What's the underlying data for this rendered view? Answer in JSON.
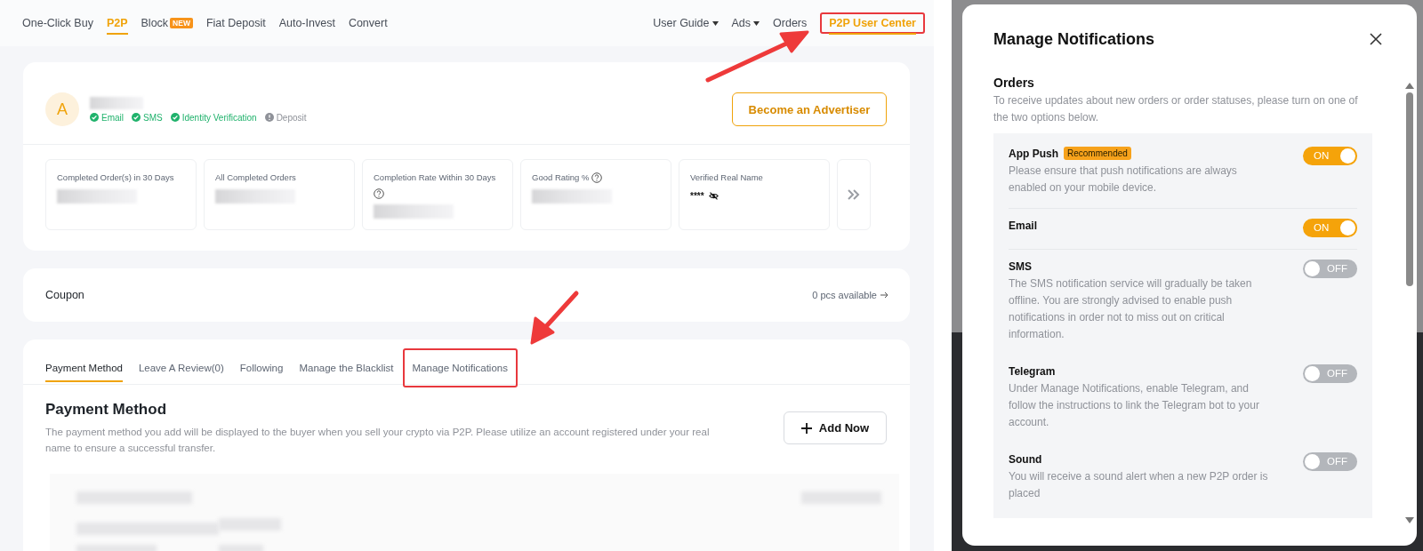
{
  "nav": {
    "items": [
      {
        "label": "One-Click Buy",
        "selected": false
      },
      {
        "label": "P2P",
        "selected": true
      },
      {
        "label": "Block",
        "selected": false,
        "badge": "NEW"
      },
      {
        "label": "Fiat Deposit",
        "selected": false
      },
      {
        "label": "Auto-Invest",
        "selected": false
      },
      {
        "label": "Convert",
        "selected": false
      }
    ],
    "right_items": [
      {
        "label": "User Guide",
        "dropdown": true,
        "selected": false,
        "highlighted": false
      },
      {
        "label": "Ads",
        "dropdown": true,
        "selected": false,
        "highlighted": false
      },
      {
        "label": "Orders",
        "dropdown": false,
        "selected": false,
        "highlighted": false
      },
      {
        "label": "P2P User Center",
        "dropdown": false,
        "selected": true,
        "highlighted": true
      }
    ]
  },
  "profile": {
    "avatar": "A",
    "verifications": [
      {
        "label": "Email",
        "verified": true
      },
      {
        "label": "SMS",
        "verified": true
      },
      {
        "label": "Identity Verification",
        "verified": true
      },
      {
        "label": "Deposit",
        "verified": false
      }
    ],
    "advertiser_button": "Become an Advertiser"
  },
  "stats": [
    {
      "label": "Completed Order(s) in 30 Days",
      "help": false,
      "kind": "redacted"
    },
    {
      "label": "All Completed Orders",
      "help": false,
      "kind": "redacted"
    },
    {
      "label": "Completion Rate Within 30 Days",
      "help": true,
      "kind": "redacted"
    },
    {
      "label": "Good Rating %",
      "help": true,
      "kind": "redacted"
    },
    {
      "label": "Verified Real Name",
      "help": false,
      "kind": "masked",
      "value": "****"
    }
  ],
  "coupon": {
    "label": "Coupon",
    "available": "0 pcs available"
  },
  "tabs": [
    {
      "label": "Payment Method",
      "selected": true,
      "highlighted": false
    },
    {
      "label": "Leave A Review(0)",
      "selected": false,
      "highlighted": false
    },
    {
      "label": "Following",
      "selected": false,
      "highlighted": false
    },
    {
      "label": "Manage the Blacklist",
      "selected": false,
      "highlighted": false
    },
    {
      "label": "Manage Notifications",
      "selected": false,
      "highlighted": true
    }
  ],
  "payment_method": {
    "title": "Payment Method",
    "description": "The payment method you add will be displayed to the buyer when you sell your crypto via P2P. Please utilize an account registered under your real name to ensure a successful transfer.",
    "add_button": "Add Now"
  },
  "modal": {
    "title": "Manage Notifications",
    "section": "Orders",
    "description": "To receive updates about new orders or order statuses, please turn on one of the two options below.",
    "options": [
      {
        "name": "App Push",
        "badge": "Recommended",
        "description": "Please ensure that push notifications are always enabled on your mobile device.",
        "on": true,
        "state_label": "ON",
        "divider": true
      },
      {
        "name": "Email",
        "on": true,
        "state_label": "ON",
        "divider": true
      },
      {
        "name": "SMS",
        "description": "The SMS notification service will gradually be taken offline. You are strongly advised to enable push notifications in order not to miss out on critical information.",
        "on": false,
        "state_label": "OFF",
        "divider": false
      },
      {
        "name": "Telegram",
        "description": "Under Manage Notifications, enable Telegram, and follow the instructions to link the Telegram bot to your account.",
        "on": false,
        "state_label": "OFF",
        "divider": false
      },
      {
        "name": "Sound",
        "description": "You will receive a sound alert when a new P2P order is placed",
        "on": false,
        "state_label": "OFF",
        "divider": false
      }
    ]
  }
}
